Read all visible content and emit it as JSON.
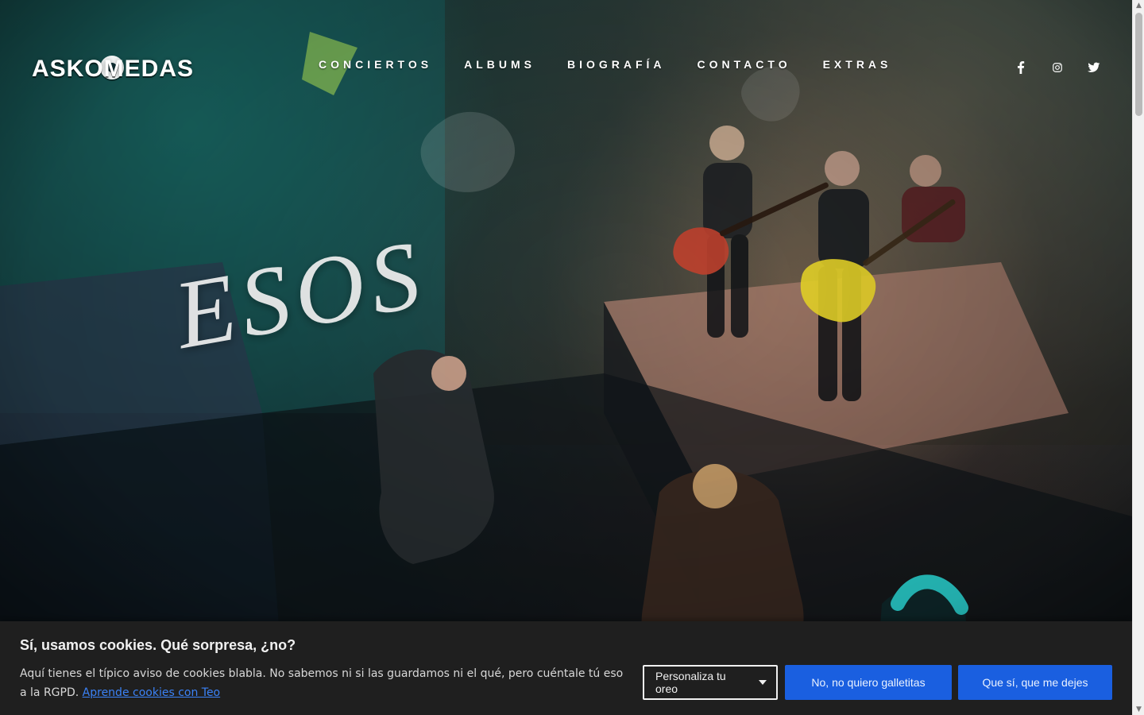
{
  "header": {
    "logo_text": "ASKOMEDAS",
    "nav": [
      {
        "label": "CONCIERTOS"
      },
      {
        "label": "ALBUMS"
      },
      {
        "label": "BIOGRAFÍA"
      },
      {
        "label": "CONTACTO"
      },
      {
        "label": "EXTRAS"
      }
    ],
    "social": [
      {
        "icon": "facebook-icon"
      },
      {
        "icon": "instagram-icon"
      },
      {
        "icon": "twitter-icon"
      }
    ]
  },
  "hero": {
    "title": "ESOS"
  },
  "cookie_banner": {
    "title": "Sí, usamos cookies. Qué sorpresa, ¿no?",
    "text": "Aquí tienes el típico aviso de cookies blabla. No sabemos ni si las guardamos ni el qué, pero cuéntale tú eso a la RGPD.",
    "link_text": "Aprende cookies con Teo",
    "buttons": {
      "customize": "Personaliza tu oreo",
      "reject": "No, no quiero galletitas",
      "accept": "Que sí, que me dejes"
    }
  }
}
